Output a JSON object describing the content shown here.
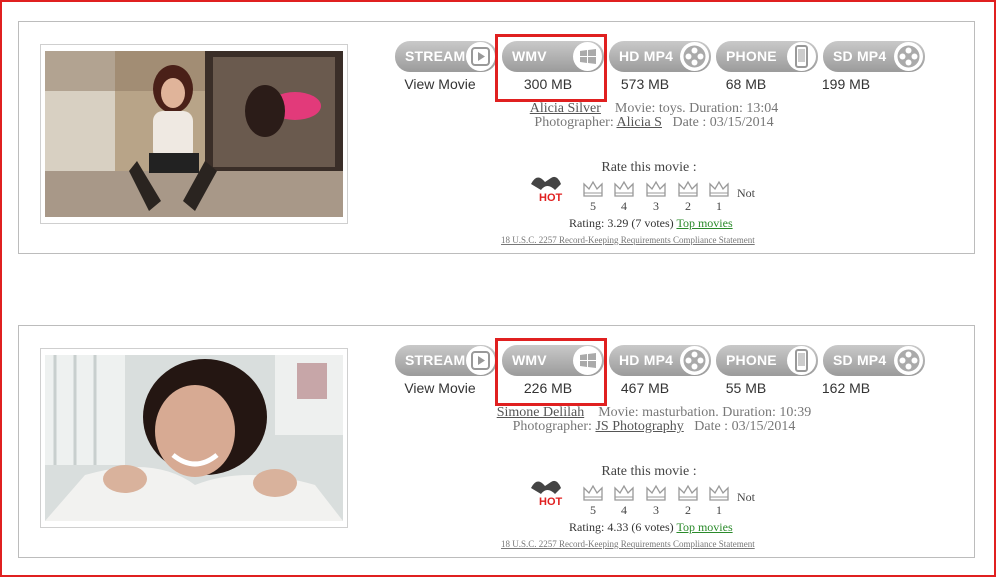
{
  "colors": {
    "highlight": "#e02020",
    "button": "#a8a8a8",
    "top_movies": "#2a8a2a"
  },
  "movies": [
    {
      "buttons": [
        {
          "label": "STREAM",
          "icon": "play-icon"
        },
        {
          "label": "WMV",
          "icon": "windows-icon"
        },
        {
          "label": "HD MP4",
          "icon": "film-reel-icon"
        },
        {
          "label": "PHONE",
          "icon": "phone-icon"
        },
        {
          "label": "SD MP4",
          "icon": "film-reel-icon"
        }
      ],
      "sizes": [
        "View Movie",
        "300 MB",
        "573 MB",
        "68 MB",
        "199 MB"
      ],
      "model": "Alicia Silver",
      "movie_text": "Movie: toys. Duration: 13:04",
      "photographer_label": "Photographer:",
      "photographer": "Alicia S",
      "date_text": "Date : 03/15/2014",
      "rate_title": "Rate this movie :",
      "hot_label": "HOT",
      "rating_numbers": [
        "5",
        "4",
        "3",
        "2",
        "1"
      ],
      "not_label": "Not",
      "rating_text": "Rating: 3.29   (7 votes)",
      "top_movies": "Top movies",
      "legal": "18 U.S.C. 2257 Record-Keeping Requirements Compliance Statement"
    },
    {
      "buttons": [
        {
          "label": "STREAM",
          "icon": "play-icon"
        },
        {
          "label": "WMV",
          "icon": "windows-icon"
        },
        {
          "label": "HD MP4",
          "icon": "film-reel-icon"
        },
        {
          "label": "PHONE",
          "icon": "phone-icon"
        },
        {
          "label": "SD MP4",
          "icon": "film-reel-icon"
        }
      ],
      "sizes": [
        "View Movie",
        "226 MB",
        "467 MB",
        "55 MB",
        "162 MB"
      ],
      "model": "Simone Delilah",
      "movie_text": "Movie: masturbation. Duration: 10:39",
      "photographer_label": "Photographer:",
      "photographer": "JS Photography",
      "date_text": "Date : 03/15/2014",
      "rate_title": "Rate this movie :",
      "hot_label": "HOT",
      "rating_numbers": [
        "5",
        "4",
        "3",
        "2",
        "1"
      ],
      "not_label": "Not",
      "rating_text": "Rating: 4.33   (6 votes)",
      "top_movies": "Top movies",
      "legal": "18 U.S.C. 2257 Record-Keeping Requirements Compliance Statement"
    }
  ]
}
